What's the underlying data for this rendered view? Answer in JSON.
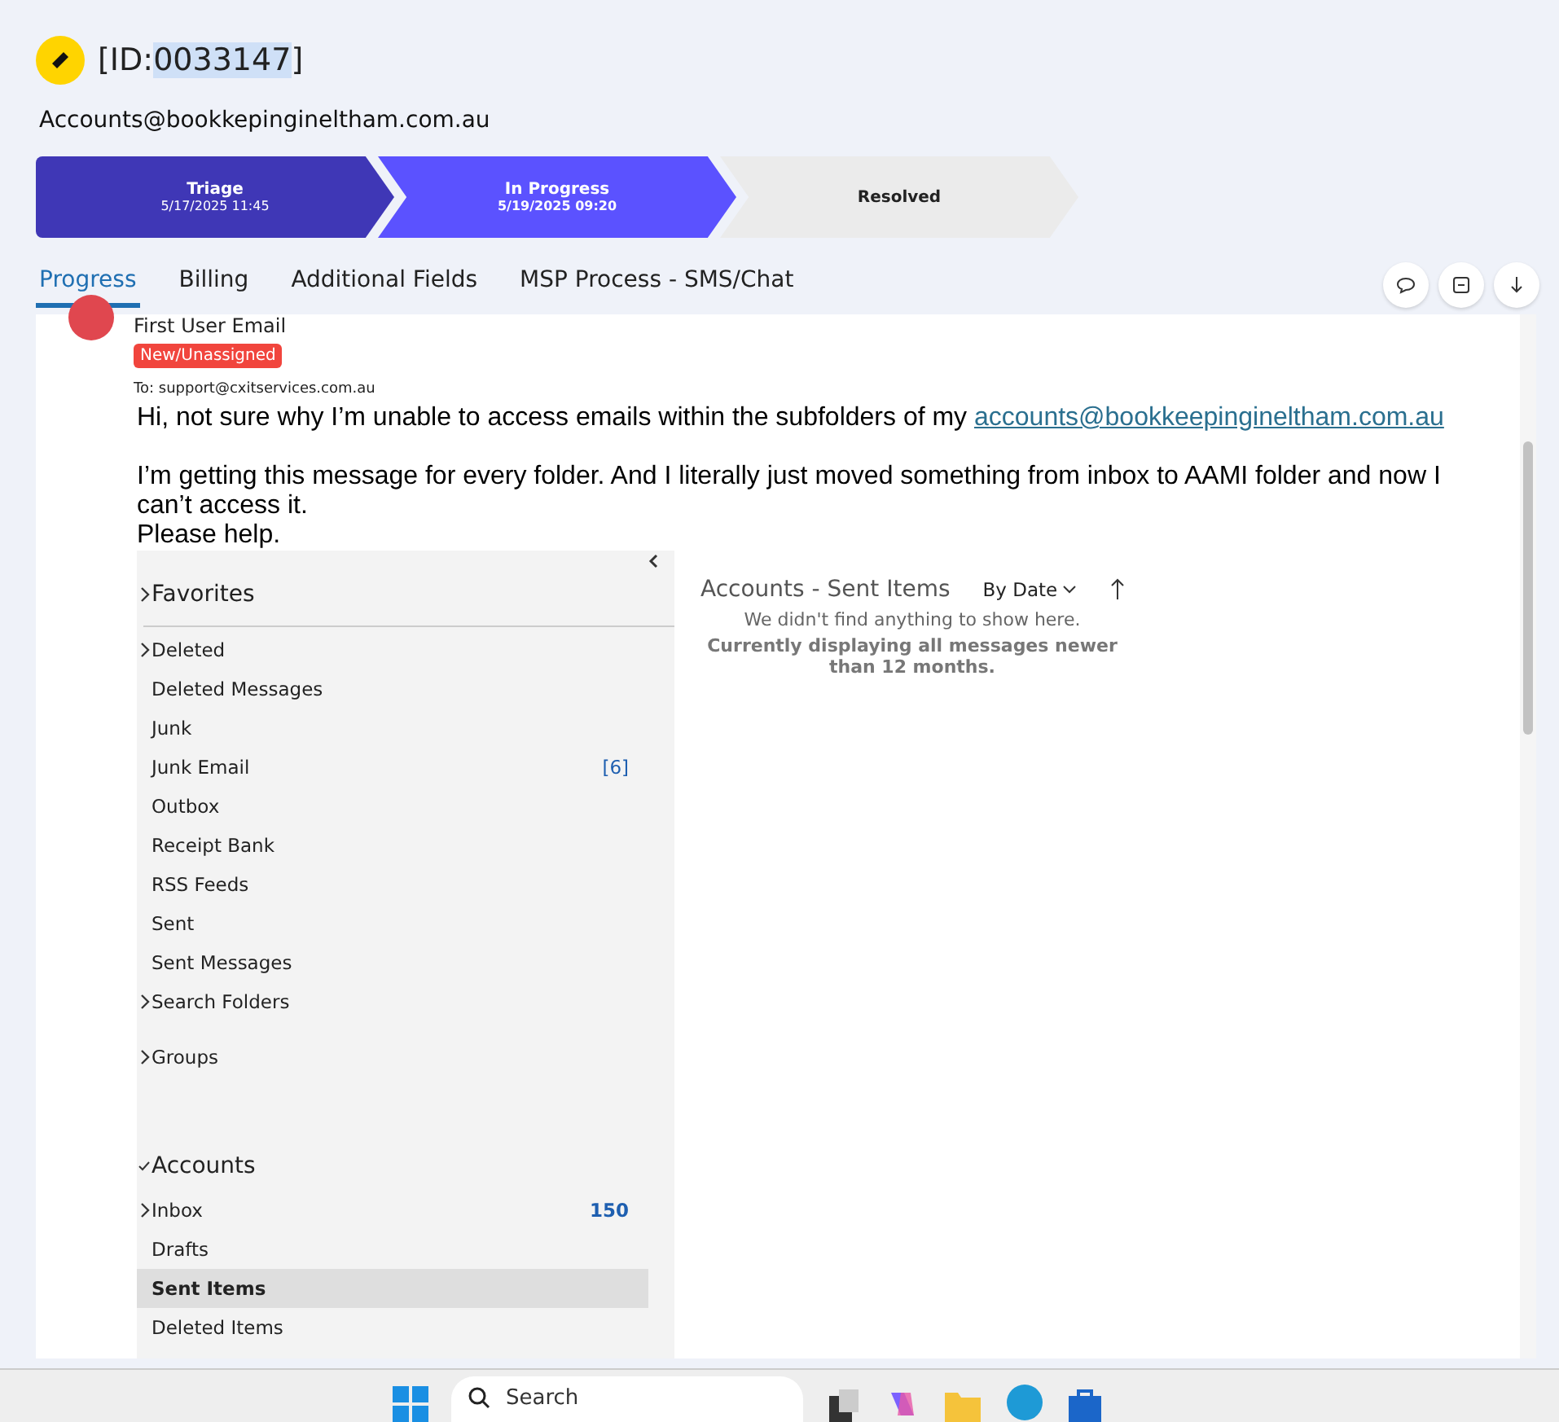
{
  "ticket": {
    "id_open": "[ID:",
    "id_number": "0033147",
    "id_close": "]",
    "contact": "Accounts@bookkepingineltham.com.au"
  },
  "stages": [
    {
      "name": "Triage",
      "date": "5/17/2025 11:45",
      "completed": true,
      "selected": false
    },
    {
      "name": "In Progress",
      "date": "5/19/2025 09:20",
      "completed": false,
      "selected": true
    },
    {
      "name": "Resolved",
      "completed": false,
      "selected": false
    }
  ],
  "tabs": [
    {
      "label": "Progress",
      "selected": true
    },
    {
      "label": "Billing",
      "selected": false
    },
    {
      "label": "Additional Fields",
      "selected": false
    },
    {
      "label": "MSP Process - SMS/Chat",
      "selected": false
    }
  ],
  "message": {
    "sender": "First User Email",
    "badge": "New/Unassigned",
    "to_label": "To:",
    "to_address": "support@cxitservices.com.au",
    "paragraphs": [
      {
        "text": "Hi, not sure why I’m unable to access emails within the subfolders of my ",
        "link": "accounts@bookkeepingineltham.com.au"
      },
      {
        "text": "I’m getting this message for every folder.  And I literally just moved something from inbox to AAMI folder and now I can’t access it."
      },
      {
        "text": "Please help."
      }
    ]
  },
  "screenshot": {
    "folders": [
      {
        "label": "Favorites",
        "kind": "header",
        "expandable": true,
        "expanded": false,
        "selected": false
      },
      {
        "label": "Deleted",
        "kind": "folder",
        "expandable": true,
        "expanded": false,
        "selected": false
      },
      {
        "label": "Deleted Messages",
        "kind": "folder",
        "expandable": false,
        "selected": false
      },
      {
        "label": "Junk",
        "kind": "folder",
        "expandable": false,
        "selected": false
      },
      {
        "label": "Junk Email",
        "kind": "folder",
        "expandable": false,
        "count": "[6]",
        "selected": false
      },
      {
        "label": "Outbox",
        "kind": "folder",
        "expandable": false,
        "selected": false
      },
      {
        "label": "Receipt Bank",
        "kind": "folder",
        "expandable": false,
        "selected": false
      },
      {
        "label": "RSS Feeds",
        "kind": "folder",
        "expandable": false,
        "selected": false
      },
      {
        "label": "Sent",
        "kind": "folder",
        "expandable": false,
        "selected": false
      },
      {
        "label": "Sent Messages",
        "kind": "folder",
        "expandable": false,
        "selected": false
      },
      {
        "label": "Search Folders",
        "kind": "folder",
        "expandable": true,
        "expanded": false,
        "selected": false
      },
      {
        "label": "Groups",
        "kind": "group",
        "expandable": true,
        "expanded": false,
        "selected": false
      },
      {
        "label": "Accounts",
        "kind": "header",
        "expandable": true,
        "expanded": true,
        "selected": false
      },
      {
        "label": "Inbox",
        "kind": "folder",
        "expandable": true,
        "expanded": false,
        "count": "150",
        "selected": false
      },
      {
        "label": "Drafts",
        "kind": "folder",
        "expandable": false,
        "selected": false
      },
      {
        "label": "Sent Items",
        "kind": "folder",
        "expandable": false,
        "selected": true
      },
      {
        "label": "Deleted Items",
        "kind": "folder",
        "expandable": false,
        "selected": false
      }
    ],
    "pane_title": "Accounts - Sent Items",
    "sort": "By Date",
    "empty_message": "We didn't find anything to show here.",
    "note": "Currently displaying all messages newer than 12 months."
  },
  "taskbar": {
    "search": {
      "placeholder": "Search"
    }
  }
}
